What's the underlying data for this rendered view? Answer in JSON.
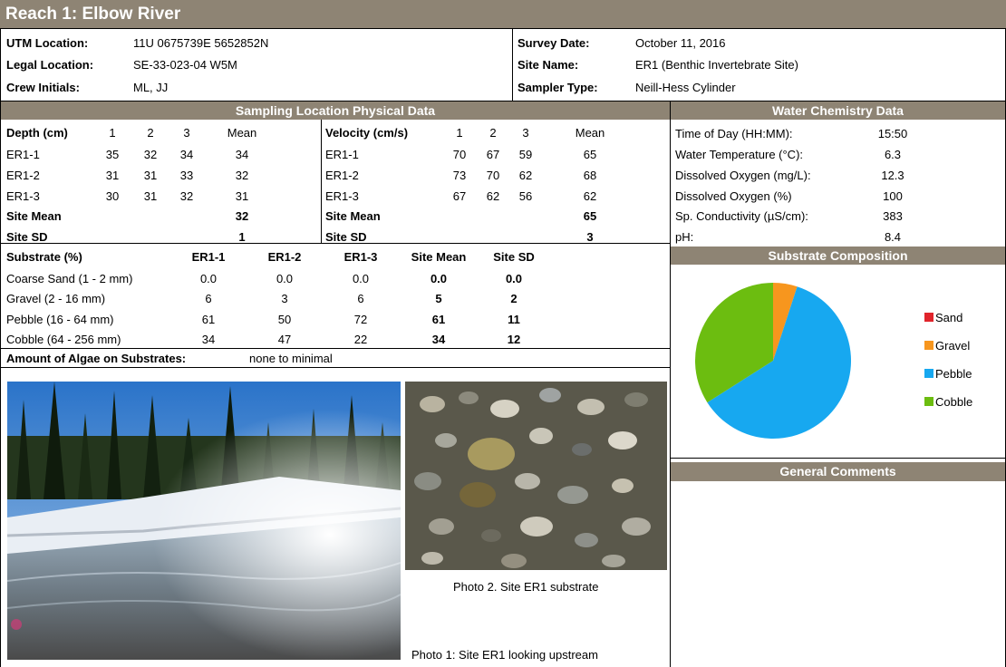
{
  "header": {
    "title": "Reach 1: Elbow River"
  },
  "site_info": {
    "utm_label": "UTM Location:",
    "utm_value": "11U  0675739E  5652852N",
    "legal_label": "Legal Location:",
    "legal_value": "SE-33-023-04 W5M",
    "crew_label": "Crew Initials:",
    "crew_value": "ML, JJ",
    "date_label": "Survey Date:",
    "date_value": "October 11, 2016",
    "site_label": "Site Name:",
    "site_value": "ER1   (Benthic Invertebrate Site)",
    "sampler_label": "Sampler Type:",
    "sampler_value": "Neill-Hess Cylinder"
  },
  "physical": {
    "title": "Sampling Location Physical Data",
    "depth": {
      "header": [
        "Depth (cm)",
        "1",
        "2",
        "3",
        "Mean"
      ],
      "rows": [
        [
          "ER1-1",
          "35",
          "32",
          "34",
          "34"
        ],
        [
          "ER1-2",
          "31",
          "31",
          "33",
          "32"
        ],
        [
          "ER1-3",
          "30",
          "31",
          "32",
          "31"
        ]
      ],
      "site_mean_label": "Site Mean",
      "site_mean": "32",
      "site_sd_label": "Site SD",
      "site_sd": "1"
    },
    "velocity": {
      "header": [
        "Velocity (cm/s)",
        "1",
        "2",
        "3",
        "Mean"
      ],
      "rows": [
        [
          "ER1-1",
          "70",
          "67",
          "59",
          "65"
        ],
        [
          "ER1-2",
          "73",
          "70",
          "62",
          "68"
        ],
        [
          "ER1-3",
          "67",
          "62",
          "56",
          "62"
        ]
      ],
      "site_mean_label": "Site Mean",
      "site_mean": "65",
      "site_sd_label": "Site SD",
      "site_sd": "3"
    },
    "substrate": {
      "header": [
        "Substrate (%)",
        "ER1-1",
        "ER1-2",
        "ER1-3",
        "Site Mean",
        "Site SD"
      ],
      "rows": [
        [
          "Coarse Sand (1 - 2 mm)",
          "0.0",
          "0.0",
          "0.0",
          "0.0",
          "0.0"
        ],
        [
          "Gravel (2 - 16 mm)",
          "6",
          "3",
          "6",
          "5",
          "2"
        ],
        [
          "Pebble (16 - 64 mm)",
          "61",
          "50",
          "72",
          "61",
          "11"
        ],
        [
          "Cobble (64 - 256 mm)",
          "34",
          "47",
          "22",
          "34",
          "12"
        ]
      ]
    },
    "algae_label": "Amount of Algae on Substrates:",
    "algae_value": "none to minimal"
  },
  "water": {
    "title": "Water Chemistry Data",
    "rows": [
      [
        "Time of Day (HH:MM):",
        "15:50"
      ],
      [
        "Water Temperature (°C):",
        "6.3"
      ],
      [
        "Dissolved Oxygen (mg/L):",
        "12.3"
      ],
      [
        "Dissolved Oxygen (%)",
        "100"
      ],
      [
        "Sp. Conductivity (µS/cm):",
        "383"
      ],
      [
        "pH:",
        "8.4"
      ]
    ]
  },
  "composition_title": "Substrate Composition",
  "comments_title": "General Comments",
  "photos": {
    "photo1_caption": "Photo 1: Site ER1 looking upstream",
    "photo2_caption": "Photo 2. Site ER1 substrate"
  },
  "chart_data": {
    "type": "pie",
    "categories": [
      "Sand",
      "Gravel",
      "Pebble",
      "Cobble"
    ],
    "values": [
      0,
      5,
      61,
      34
    ],
    "colors": [
      "#e0242b",
      "#f7961e",
      "#17a8f0",
      "#6cbd10"
    ],
    "legend_position": "right"
  }
}
